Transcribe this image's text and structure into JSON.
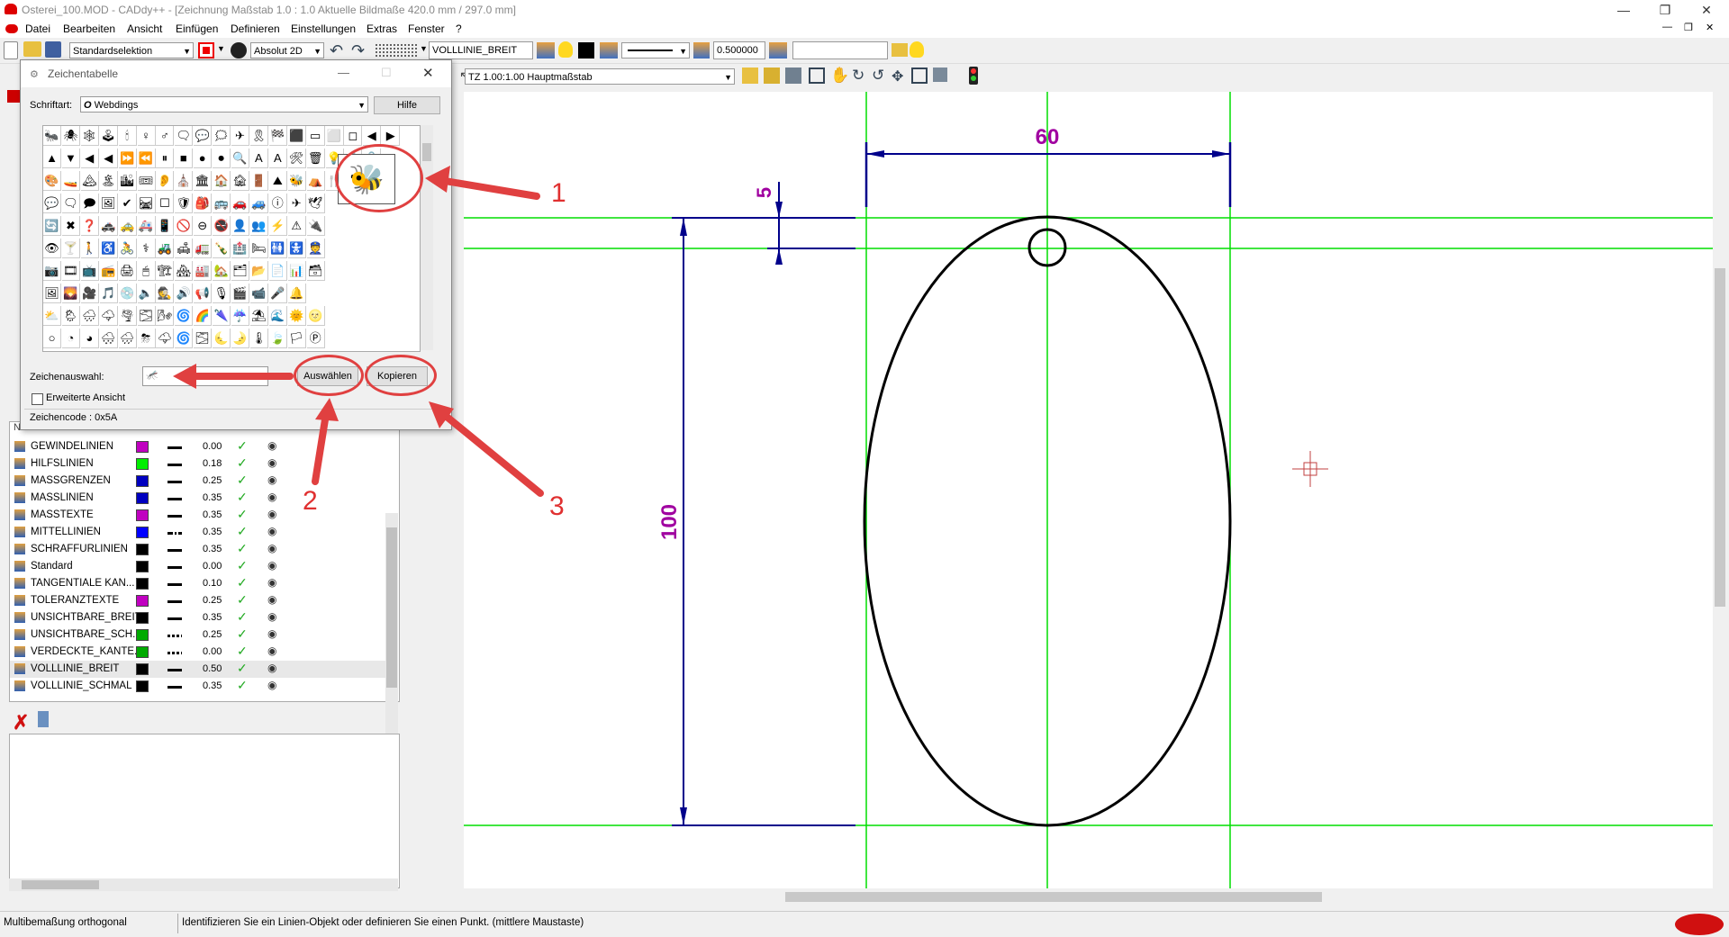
{
  "window": {
    "title": "Osterei_100.MOD  -  CADdy++ - [Zeichnung    Maßstab 1.0 : 1.0    Aktuelle Bildmaße 420.0 mm / 297.0 mm]"
  },
  "menu": [
    "Datei",
    "Bearbeiten",
    "Ansicht",
    "Einfügen",
    "Definieren",
    "Einstellungen",
    "Extras",
    "Fenster",
    "?"
  ],
  "toolbar": {
    "selection_mode": "Standardselektion",
    "coord_mode": "Absolut 2D",
    "layer_name": "VOLLLINIE_BREIT",
    "line_width": "0.500000",
    "text_field": "",
    "scale_combo": "TZ 1.00:1.00 Hauptmaßstab"
  },
  "dialog": {
    "title": "Zeichentabelle",
    "font_label": "Schriftart:",
    "font_value": "Webdings",
    "help_button": "Hilfe",
    "selection_label": "Zeichenauswahl:",
    "selection_value": "🦟",
    "select_button": "Auswählen",
    "copy_button": "Kopieren",
    "extended_view_label": "Erweiterte Ansicht",
    "char_code": "Zeichencode : 0x5A",
    "zoomed_glyph": "🐝",
    "glyph_rows": [
      "🐜🕷🕸🕹🕯♀♂🗨💬🗯✈🎗🏁⬛▭⬜◻◀▶",
      "▲▼◀◀⏩⏪⏸■●⏺🔍AA🛠🗑💡🔒🔓",
      "🎨🚤🏔🏝🏙🎟👂⛪🏛🏠🏚🚪⛰🐝⛺🍴",
      "💬🗨🗩🖼✔🛤☐🛡🎒🚌🚗🚙ⓘ✈🕊",
      "🔄✖❓🚓🚕🚑📱🚫⊖🚭👤👥⚡⚠🔌",
      "👁🍸🚶♿🚴⚕🚜🛋🚛🍾🏥🛏🚻🚼👮",
      "📷🎞📺📻🖨🖱🏗🏘🏭🏡🗂📂📄📊🗃",
      "🖼🌄🎥🎵💿🔈🕵🔊📢🎙🎬📹🎤🔔",
      "⛅🌦🌧🌩🌪🌫🌬🌀🌈🌂☔⛱🌊🌞🌝",
      "○◔◕🌨🌧⛈🌩🌀🌫🌜🌛🌡🍃🏳Ⓟ"
    ]
  },
  "annotations": {
    "n1": "1",
    "n2": "2",
    "n3": "3"
  },
  "layers": {
    "header_name": "Name",
    "rows": [
      {
        "name": "GEWINDELINIEN",
        "color": "#c000c0",
        "style": "solid",
        "width": "0.00"
      },
      {
        "name": "HILFSLINIEN",
        "color": "#00ee00",
        "style": "solid",
        "width": "0.18"
      },
      {
        "name": "MASSGRENZEN",
        "color": "#0000c0",
        "style": "solid",
        "width": "0.25"
      },
      {
        "name": "MASSLINIEN",
        "color": "#0000c0",
        "style": "solid",
        "width": "0.35"
      },
      {
        "name": "MASSTEXTE",
        "color": "#c000c0",
        "style": "solid",
        "width": "0.35"
      },
      {
        "name": "MITTELLINIEN",
        "color": "#0000ff",
        "style": "dashdot",
        "width": "0.35"
      },
      {
        "name": "SCHRAFFURLINIEN",
        "color": "#000000",
        "style": "solid",
        "width": "0.35"
      },
      {
        "name": "Standard",
        "color": "#000000",
        "style": "solid",
        "width": "0.00"
      },
      {
        "name": "TANGENTIALE KAN...",
        "color": "#000000",
        "style": "solid",
        "width": "0.10"
      },
      {
        "name": "TOLERANZTEXTE",
        "color": "#c000c0",
        "style": "solid",
        "width": "0.25"
      },
      {
        "name": "UNSICHTBARE_BREIT",
        "color": "#000000",
        "style": "solid",
        "width": "0.35"
      },
      {
        "name": "UNSICHTBARE_SCH...",
        "color": "#00aa00",
        "style": "dashed",
        "width": "0.25"
      },
      {
        "name": "VERDECKTE_KANTE...",
        "color": "#00aa00",
        "style": "dashed",
        "width": "0.00"
      },
      {
        "name": "VOLLLINIE_BREIT",
        "color": "#000000",
        "style": "solid",
        "width": "0.50"
      },
      {
        "name": "VOLLLINIE_SCHMAL",
        "color": "#000000",
        "style": "solid",
        "width": "0.35"
      }
    ]
  },
  "drawing": {
    "dim_width": "60",
    "dim_small": "5",
    "dim_height": "100"
  },
  "status": {
    "left": "Multibemaßung orthogonal",
    "message": "Identifizieren Sie ein Linien-Objekt oder definieren Sie einen Punkt.  (mittlere Maustaste)"
  },
  "colors": {
    "construction": "#00dd00",
    "dimension": "#00008b",
    "dimtext": "#a000a0",
    "annotation": "#e04040"
  }
}
